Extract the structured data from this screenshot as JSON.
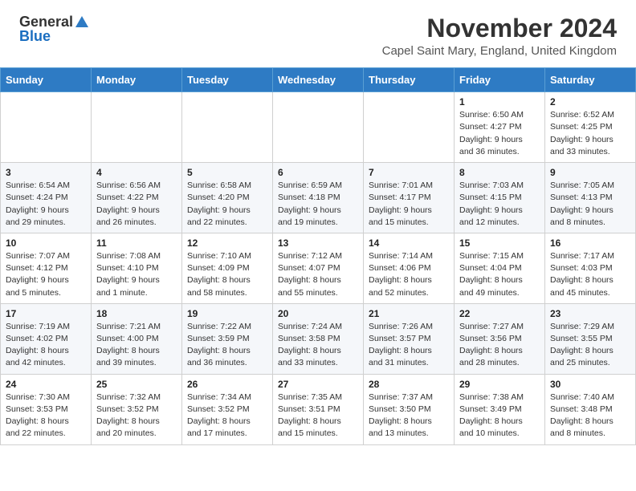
{
  "header": {
    "logo_general": "General",
    "logo_blue": "Blue",
    "month_title": "November 2024",
    "subtitle": "Capel Saint Mary, England, United Kingdom"
  },
  "days_of_week": [
    "Sunday",
    "Monday",
    "Tuesday",
    "Wednesday",
    "Thursday",
    "Friday",
    "Saturday"
  ],
  "weeks": [
    [
      {
        "day": "",
        "info": ""
      },
      {
        "day": "",
        "info": ""
      },
      {
        "day": "",
        "info": ""
      },
      {
        "day": "",
        "info": ""
      },
      {
        "day": "",
        "info": ""
      },
      {
        "day": "1",
        "info": "Sunrise: 6:50 AM\nSunset: 4:27 PM\nDaylight: 9 hours\nand 36 minutes."
      },
      {
        "day": "2",
        "info": "Sunrise: 6:52 AM\nSunset: 4:25 PM\nDaylight: 9 hours\nand 33 minutes."
      }
    ],
    [
      {
        "day": "3",
        "info": "Sunrise: 6:54 AM\nSunset: 4:24 PM\nDaylight: 9 hours\nand 29 minutes."
      },
      {
        "day": "4",
        "info": "Sunrise: 6:56 AM\nSunset: 4:22 PM\nDaylight: 9 hours\nand 26 minutes."
      },
      {
        "day": "5",
        "info": "Sunrise: 6:58 AM\nSunset: 4:20 PM\nDaylight: 9 hours\nand 22 minutes."
      },
      {
        "day": "6",
        "info": "Sunrise: 6:59 AM\nSunset: 4:18 PM\nDaylight: 9 hours\nand 19 minutes."
      },
      {
        "day": "7",
        "info": "Sunrise: 7:01 AM\nSunset: 4:17 PM\nDaylight: 9 hours\nand 15 minutes."
      },
      {
        "day": "8",
        "info": "Sunrise: 7:03 AM\nSunset: 4:15 PM\nDaylight: 9 hours\nand 12 minutes."
      },
      {
        "day": "9",
        "info": "Sunrise: 7:05 AM\nSunset: 4:13 PM\nDaylight: 9 hours\nand 8 minutes."
      }
    ],
    [
      {
        "day": "10",
        "info": "Sunrise: 7:07 AM\nSunset: 4:12 PM\nDaylight: 9 hours\nand 5 minutes."
      },
      {
        "day": "11",
        "info": "Sunrise: 7:08 AM\nSunset: 4:10 PM\nDaylight: 9 hours\nand 1 minute."
      },
      {
        "day": "12",
        "info": "Sunrise: 7:10 AM\nSunset: 4:09 PM\nDaylight: 8 hours\nand 58 minutes."
      },
      {
        "day": "13",
        "info": "Sunrise: 7:12 AM\nSunset: 4:07 PM\nDaylight: 8 hours\nand 55 minutes."
      },
      {
        "day": "14",
        "info": "Sunrise: 7:14 AM\nSunset: 4:06 PM\nDaylight: 8 hours\nand 52 minutes."
      },
      {
        "day": "15",
        "info": "Sunrise: 7:15 AM\nSunset: 4:04 PM\nDaylight: 8 hours\nand 49 minutes."
      },
      {
        "day": "16",
        "info": "Sunrise: 7:17 AM\nSunset: 4:03 PM\nDaylight: 8 hours\nand 45 minutes."
      }
    ],
    [
      {
        "day": "17",
        "info": "Sunrise: 7:19 AM\nSunset: 4:02 PM\nDaylight: 8 hours\nand 42 minutes."
      },
      {
        "day": "18",
        "info": "Sunrise: 7:21 AM\nSunset: 4:00 PM\nDaylight: 8 hours\nand 39 minutes."
      },
      {
        "day": "19",
        "info": "Sunrise: 7:22 AM\nSunset: 3:59 PM\nDaylight: 8 hours\nand 36 minutes."
      },
      {
        "day": "20",
        "info": "Sunrise: 7:24 AM\nSunset: 3:58 PM\nDaylight: 8 hours\nand 33 minutes."
      },
      {
        "day": "21",
        "info": "Sunrise: 7:26 AM\nSunset: 3:57 PM\nDaylight: 8 hours\nand 31 minutes."
      },
      {
        "day": "22",
        "info": "Sunrise: 7:27 AM\nSunset: 3:56 PM\nDaylight: 8 hours\nand 28 minutes."
      },
      {
        "day": "23",
        "info": "Sunrise: 7:29 AM\nSunset: 3:55 PM\nDaylight: 8 hours\nand 25 minutes."
      }
    ],
    [
      {
        "day": "24",
        "info": "Sunrise: 7:30 AM\nSunset: 3:53 PM\nDaylight: 8 hours\nand 22 minutes."
      },
      {
        "day": "25",
        "info": "Sunrise: 7:32 AM\nSunset: 3:52 PM\nDaylight: 8 hours\nand 20 minutes."
      },
      {
        "day": "26",
        "info": "Sunrise: 7:34 AM\nSunset: 3:52 PM\nDaylight: 8 hours\nand 17 minutes."
      },
      {
        "day": "27",
        "info": "Sunrise: 7:35 AM\nSunset: 3:51 PM\nDaylight: 8 hours\nand 15 minutes."
      },
      {
        "day": "28",
        "info": "Sunrise: 7:37 AM\nSunset: 3:50 PM\nDaylight: 8 hours\nand 13 minutes."
      },
      {
        "day": "29",
        "info": "Sunrise: 7:38 AM\nSunset: 3:49 PM\nDaylight: 8 hours\nand 10 minutes."
      },
      {
        "day": "30",
        "info": "Sunrise: 7:40 AM\nSunset: 3:48 PM\nDaylight: 8 hours\nand 8 minutes."
      }
    ]
  ]
}
